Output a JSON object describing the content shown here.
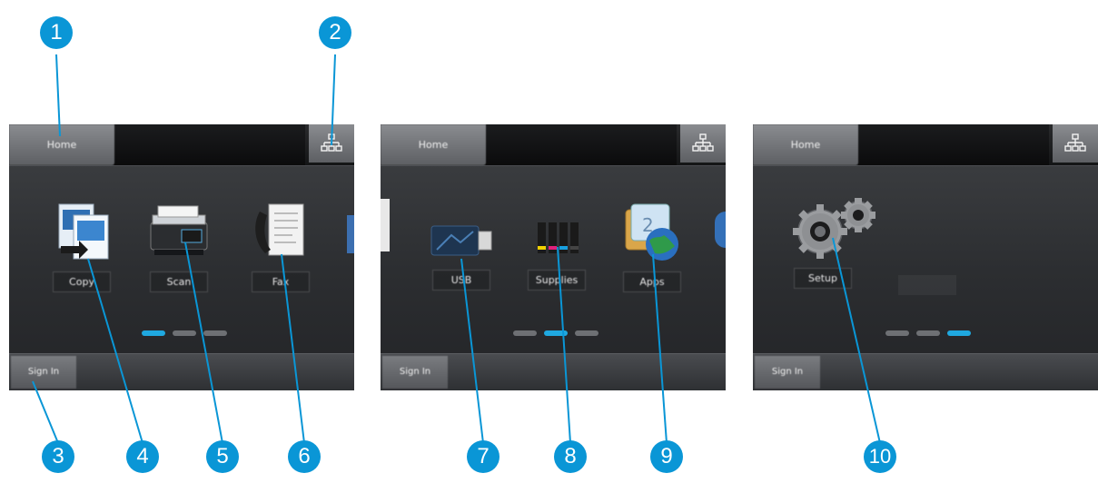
{
  "panels": [
    {
      "home_label": "Home",
      "sign_label": "Sign In",
      "apps": [
        {
          "label": "Copy",
          "icon": "copy-icon"
        },
        {
          "label": "Scan",
          "icon": "scanner-icon"
        },
        {
          "label": "Fax",
          "icon": "fax-icon"
        }
      ],
      "page_indicator": {
        "pages": 3,
        "active": 1
      }
    },
    {
      "home_label": "Home",
      "sign_label": "Sign In",
      "apps": [
        {
          "label": "USB",
          "icon": "usb-drive-icon"
        },
        {
          "label": "Supplies",
          "icon": "ink-cartridges-icon"
        },
        {
          "label": "Apps",
          "icon": "apps-globe-icon"
        }
      ],
      "page_indicator": {
        "pages": 3,
        "active": 2
      }
    },
    {
      "home_label": "Home",
      "sign_label": "Sign In",
      "apps": [
        {
          "label": "Setup",
          "icon": "gears-icon"
        }
      ],
      "page_indicator": {
        "pages": 3,
        "active": 3
      }
    }
  ],
  "callouts": [
    "1",
    "2",
    "3",
    "4",
    "5",
    "6",
    "7",
    "8",
    "9",
    "10"
  ],
  "colors": {
    "callout": "#0a96d6",
    "active_page": "#1fa8e0"
  }
}
